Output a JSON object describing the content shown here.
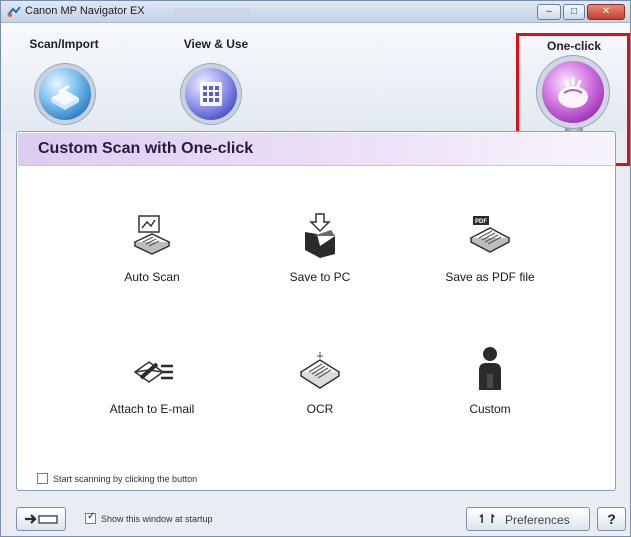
{
  "window": {
    "title": "Canon MP Navigator EX",
    "controls": {
      "minimize": "–",
      "maximize": "□",
      "close": "✕"
    }
  },
  "modes": {
    "scan_import": "Scan/Import",
    "view_use": "View & Use",
    "one_click": "One-click"
  },
  "panel": {
    "title": "Custom Scan with One-click",
    "items": [
      {
        "label": "Auto Scan",
        "icon": "auto-scan-icon"
      },
      {
        "label": "Save to PC",
        "icon": "save-to-pc-icon"
      },
      {
        "label": "Save as PDF file",
        "icon": "pdf-icon"
      },
      {
        "label": "Attach to E-mail",
        "icon": "email-icon"
      },
      {
        "label": "OCR",
        "icon": "ocr-icon"
      },
      {
        "label": "Custom",
        "icon": "custom-person-icon"
      }
    ],
    "start_scanning_checkbox": {
      "label": "Start scanning by clicking the button",
      "checked": false
    }
  },
  "footer": {
    "show_window_checkbox": {
      "label": "Show this window at startup",
      "checked": true
    },
    "preferences_label": "Preferences",
    "preferences_icon": "↿↾",
    "help_label": "?"
  },
  "colors": {
    "highlight": "#e01010",
    "one_click_orb": "#9a2fb3",
    "panel_header": "#dccdf0"
  }
}
